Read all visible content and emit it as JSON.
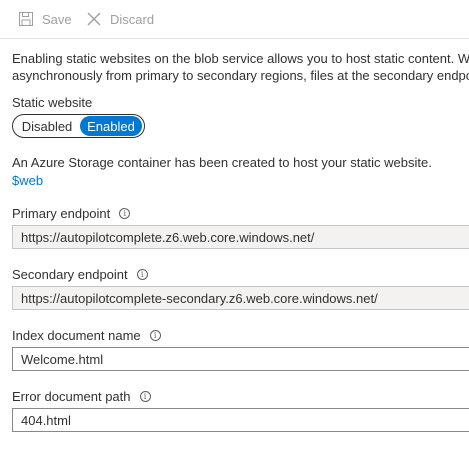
{
  "toolbar": {
    "save_label": "Save",
    "discard_label": "Discard"
  },
  "description": {
    "line1": "Enabling static websites on the blob service allows you to host static content. We",
    "line2": "asynchronously from primary to secondary regions, files at the secondary endpo"
  },
  "static_website": {
    "label": "Static website",
    "options": [
      "Disabled",
      "Enabled"
    ],
    "selected": "Enabled"
  },
  "container_note": "An Azure Storage container has been created to host your static website.",
  "container_link": "$web",
  "primary_endpoint": {
    "label": "Primary endpoint",
    "value": "https://autopilotcomplete.z6.web.core.windows.net/"
  },
  "secondary_endpoint": {
    "label": "Secondary endpoint",
    "value": "https://autopilotcomplete-secondary.z6.web.core.windows.net/"
  },
  "index_document": {
    "label": "Index document name",
    "value": "Welcome.html"
  },
  "error_document": {
    "label": "Error document path",
    "value": "404.html"
  },
  "icons": {
    "save": "save-icon",
    "discard": "close-icon",
    "info": "info-icon"
  },
  "colors": {
    "accent": "#0078d4",
    "disabled_text": "#a19f9d",
    "readonly_bg": "#f3f2f1"
  }
}
